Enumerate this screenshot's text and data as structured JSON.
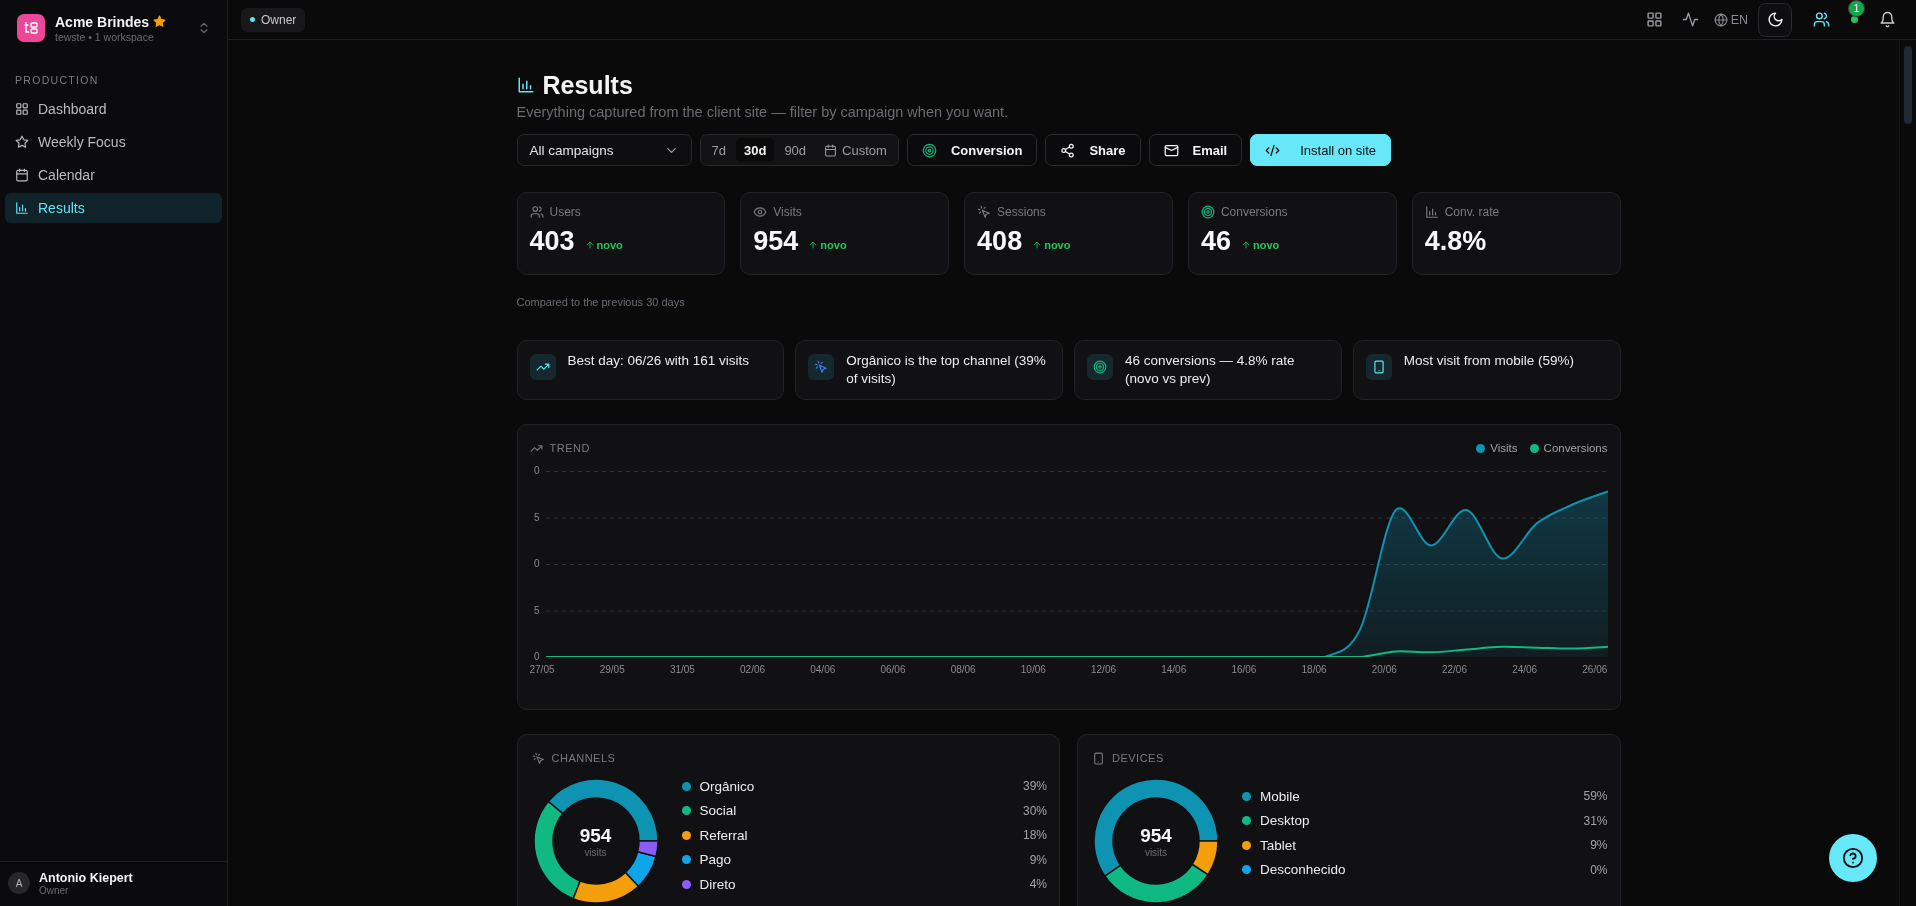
{
  "sidebar": {
    "workspace": {
      "name": "Acme Brindes",
      "subtitle": "tewste • 1 workspace",
      "favorite": true
    },
    "section": "PRODUCTION",
    "items": [
      {
        "label": "Dashboard",
        "selected": false
      },
      {
        "label": "Weekly Focus",
        "selected": false
      },
      {
        "label": "Calendar",
        "selected": false
      },
      {
        "label": "Results",
        "selected": true
      }
    ],
    "user": {
      "initial": "A",
      "name": "Antonio Kiepert",
      "role": "Owner"
    }
  },
  "topbar": {
    "role_chip": "Owner",
    "language": "EN",
    "notifications": "1"
  },
  "page": {
    "title": "Results",
    "subtitle": "Everything captured from the client site — filter by campaign when you want.",
    "campaign_select": {
      "value": "All campaigns"
    },
    "ranges": [
      {
        "label": "7d",
        "selected": false
      },
      {
        "label": "30d",
        "selected": true
      },
      {
        "label": "90d",
        "selected": false
      },
      {
        "label": "Custom",
        "selected": false
      }
    ],
    "actions": [
      {
        "label": "Conversion",
        "kind": "outline"
      },
      {
        "label": "Share",
        "kind": "outline"
      },
      {
        "label": "Email",
        "kind": "outline"
      },
      {
        "label": "Install on site",
        "kind": "primary"
      }
    ]
  },
  "stats": [
    {
      "label": "Users",
      "value": "403",
      "delta": "novo"
    },
    {
      "label": "Visits",
      "value": "954",
      "delta": "novo"
    },
    {
      "label": "Sessions",
      "value": "408",
      "delta": "novo"
    },
    {
      "label": "Conversions",
      "value": "46",
      "delta": "novo"
    },
    {
      "label": "Conv. rate",
      "value": "4.8%"
    }
  ],
  "comparison_note": "Compared to the previous 30 days",
  "insights": [
    {
      "text": "Best day: 06/26 with 161 visits"
    },
    {
      "text": "Orgânico is the top channel (39% of visits)"
    },
    {
      "text": "46 conversions — 4.8% rate (novo vs prev)"
    },
    {
      "text": "Most visit from mobile (59%)"
    }
  ],
  "trend": {
    "title": "TREND",
    "legend": [
      {
        "name": "Visits",
        "color": "#0e93b3"
      },
      {
        "name": "Conversions",
        "color": "#10b981"
      }
    ],
    "y_labels": [
      "0",
      "5",
      "0",
      "5",
      "0"
    ],
    "x_labels": [
      "27/05",
      "29/05",
      "31/05",
      "02/06",
      "04/06",
      "06/06",
      "08/06",
      "10/06",
      "12/06",
      "14/06",
      "16/06",
      "18/06",
      "20/06",
      "22/06",
      "24/06",
      "26/06"
    ]
  },
  "channels": {
    "title": "CHANNELS",
    "total": "954",
    "total_label": "visits",
    "items": [
      {
        "share": "39%",
        "color": "#0e93b3"
      },
      {
        "share": "30%",
        "color": "#10b981"
      },
      {
        "share": "18%",
        "color": "#f59e0b"
      },
      {
        "share": "9%",
        "color": "#0ea5e9"
      },
      {
        "share": "4%",
        "color": "#8b5cf6"
      }
    ],
    "chart_data": {
      "type": "donut",
      "categories": [
        "Orgânico",
        "Social",
        "Referral",
        "Pago",
        "Direto"
      ],
      "values": [
        39,
        30,
        18,
        9,
        4
      ]
    }
  },
  "devices": {
    "title": "DEVICES",
    "total": "954",
    "total_label": "visits",
    "items": [
      {
        "share": "59%",
        "color": "#0e93b3"
      },
      {
        "share": "31%",
        "color": "#10b981"
      },
      {
        "share": "9%",
        "color": "#f59e0b"
      },
      {
        "share": "0%",
        "color": "#0ea5e9"
      }
    ],
    "chart_data": {
      "type": "donut",
      "categories": [
        "Mobile",
        "Desktop",
        "Tablet",
        "Desconhecido"
      ],
      "values": [
        59,
        31,
        9,
        0
      ]
    }
  }
}
